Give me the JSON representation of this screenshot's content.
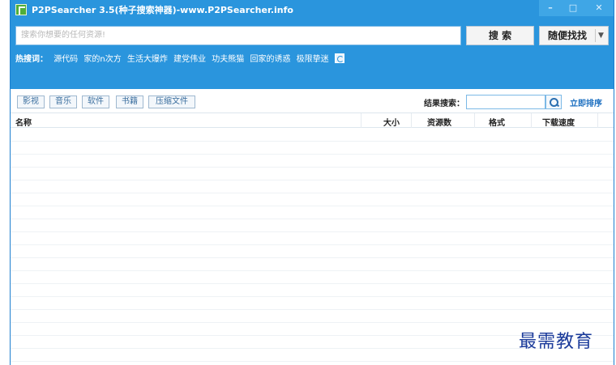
{
  "window": {
    "title": "P2PSearcher 3.5(种子搜索神器)-www.P2PSearcher.info",
    "controls": {
      "minimize": "–",
      "maximize": "□",
      "close": "✕"
    }
  },
  "search": {
    "placeholder": "搜索你想要的任何资源!",
    "search_button": "搜 索",
    "random_button": "随便找找",
    "random_dropdown": "▼"
  },
  "hot": {
    "label": "热搜词：",
    "terms": [
      "源代码",
      "家的n次方",
      "生活大爆炸",
      "建党伟业",
      "功夫熊猫",
      "回家的诱惑",
      "极限挚迷"
    ]
  },
  "categories": [
    "影视",
    "音乐",
    "软件",
    "书籍",
    "压缩文件"
  ],
  "result_filter": {
    "label": "结果搜索：",
    "value": "",
    "sort_link": "立即排序"
  },
  "table": {
    "columns": [
      "名称",
      "大小",
      "资源数",
      "格式",
      "下载速度"
    ],
    "rows": []
  },
  "watermark": "最需教育",
  "colors": {
    "accent": "#2a95dd",
    "link": "#1c6fc0"
  },
  "icons": {
    "app": "app-icon",
    "refresh": "refresh-icon",
    "search": "magnifier-icon"
  }
}
